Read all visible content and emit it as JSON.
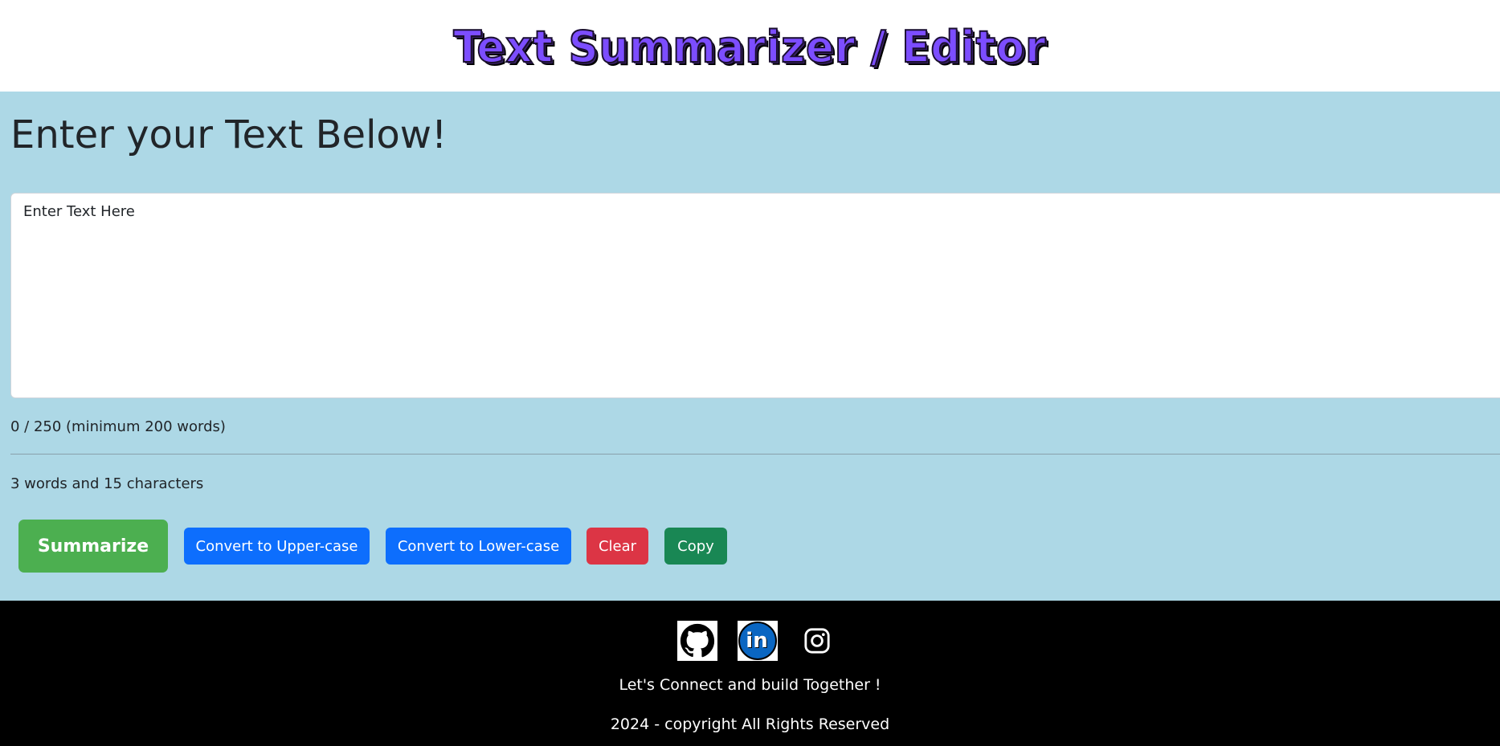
{
  "header": {
    "logo_text": "Text Summarizer / Editor"
  },
  "main": {
    "heading": "Enter your Text Below!",
    "textarea": {
      "placeholder": "Enter Text Here",
      "value": ""
    },
    "limit_text": "0 / 250 (minimum 200 words)",
    "stats_text": "3 words and 15 characters",
    "buttons": {
      "summarize": "Summarize",
      "upper": "Convert to Upper-case",
      "lower": "Convert to Lower-case",
      "clear": "Clear",
      "copy": "Copy"
    }
  },
  "footer": {
    "icons": [
      "github-icon",
      "linkedin-icon",
      "instagram-icon"
    ],
    "tagline": "Let's Connect and build Together !",
    "copyright": "2024 - copyright All Rights Reserved"
  },
  "colors": {
    "main_bg": "#add8e6",
    "summarize": "#4caf50",
    "primary": "#0d6efd",
    "danger": "#dc3545",
    "success": "#198754",
    "logo": "#7c4dff",
    "linkedin": "#0a66c2"
  }
}
